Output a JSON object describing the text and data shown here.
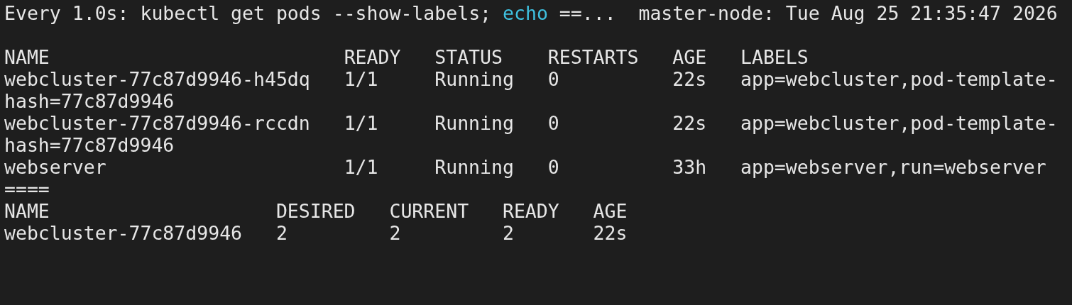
{
  "header": {
    "command": "Every 1.0s: kubectl get pods --show-labels;",
    "keyword": "echo",
    "command_rest": "==...",
    "status": "master-node: Tue Aug 25 21:35:47 2026"
  },
  "pods": {
    "columns": [
      "NAME",
      "READY",
      "STATUS",
      "RESTARTS",
      "AGE",
      "LABELS"
    ],
    "rows": [
      {
        "name": "webcluster-77c87d9946-h45dq",
        "ready": "1/1",
        "status": "Running",
        "restarts": "0",
        "age": "22s",
        "labels": "app=webcluster,pod-template-",
        "labels_continued": "hash=77c87d9946"
      },
      {
        "name": "webcluster-77c87d9946-rccdn",
        "ready": "1/1",
        "status": "Running",
        "restarts": "0",
        "age": "22s",
        "labels": "app=webcluster,pod-template-",
        "labels_continued": "hash=77c87d9946"
      },
      {
        "name": "webserver",
        "ready": "1/1",
        "status": "Running",
        "restarts": "0",
        "age": "33h",
        "labels": "app=webserver,run=webserver"
      }
    ]
  },
  "separator": "====",
  "replicasets": {
    "columns": [
      "NAME",
      "DESIRED",
      "CURRENT",
      "READY",
      "AGE"
    ],
    "rows": [
      {
        "name": "webcluster-77c87d9946",
        "desired": "2",
        "current": "2",
        "ready": "2",
        "age": "22s"
      }
    ]
  }
}
